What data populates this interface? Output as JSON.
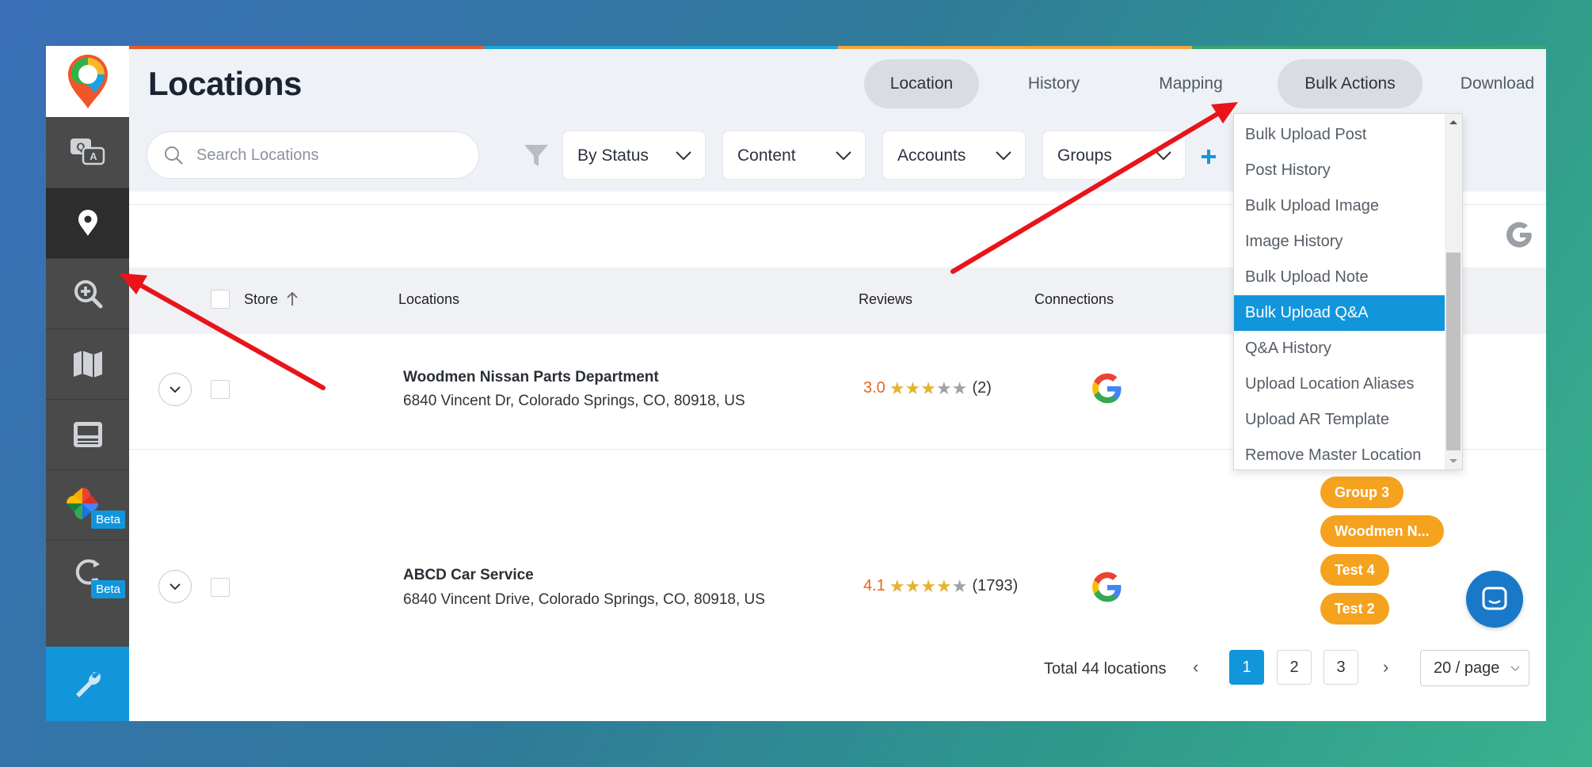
{
  "header": {
    "title": "Locations",
    "tabs": [
      {
        "label": "Location"
      },
      {
        "label": "History"
      },
      {
        "label": "Mapping"
      },
      {
        "label": "Bulk Actions"
      },
      {
        "label": "Download"
      }
    ]
  },
  "filters": {
    "search_placeholder": "Search Locations",
    "dropdowns": [
      {
        "label": "By Status"
      },
      {
        "label": "Content"
      },
      {
        "label": "Accounts"
      },
      {
        "label": "Groups"
      }
    ]
  },
  "sidebar": {
    "items": [
      {
        "icon": "qa-icon"
      },
      {
        "icon": "location-pin-icon"
      },
      {
        "icon": "zoom-in-icon"
      },
      {
        "icon": "map-icon"
      },
      {
        "icon": "report-icon"
      },
      {
        "icon": "photos-icon",
        "badge": "Beta"
      },
      {
        "icon": "search-refresh-icon",
        "badge": "Beta"
      },
      {
        "icon": "wrench-icon"
      }
    ]
  },
  "table": {
    "headers": {
      "store": "Store",
      "locations": "Locations",
      "reviews": "Reviews",
      "connections": "Connections"
    },
    "rows": [
      {
        "name": "Woodmen Nissan Parts Department",
        "address": "6840 Vincent Dr, Colorado Springs, CO, 80918, US",
        "rating": "3.0",
        "stars_filled": 3,
        "review_count": "(2)"
      },
      {
        "name": "ABCD Car Service",
        "address": "6840 Vincent Drive, Colorado Springs, CO, 80918, US",
        "rating": "4.1",
        "stars_filled": 4,
        "review_count": "(1793)",
        "groups": [
          "Group 3",
          "Woodmen N...",
          "Test 4",
          "Test 2"
        ]
      }
    ]
  },
  "bulk_menu": {
    "items": [
      "Bulk Upload Post",
      "Post History",
      "Bulk Upload Image",
      "Image History",
      "Bulk Upload Note",
      "Bulk Upload Q&A",
      "Q&A History",
      "Upload Location Aliases",
      "Upload AR Template",
      "Remove Master Location"
    ],
    "selected": "Bulk Upload Q&A"
  },
  "pagination": {
    "total": "Total 44 locations",
    "pages": [
      "1",
      "2",
      "3"
    ],
    "current": "1",
    "page_size": "20 / page"
  },
  "colors": {
    "accent": "#1296db",
    "tag": "#f5a21f",
    "rating": "#e8641e",
    "annotation_arrow": "#e8141a"
  }
}
